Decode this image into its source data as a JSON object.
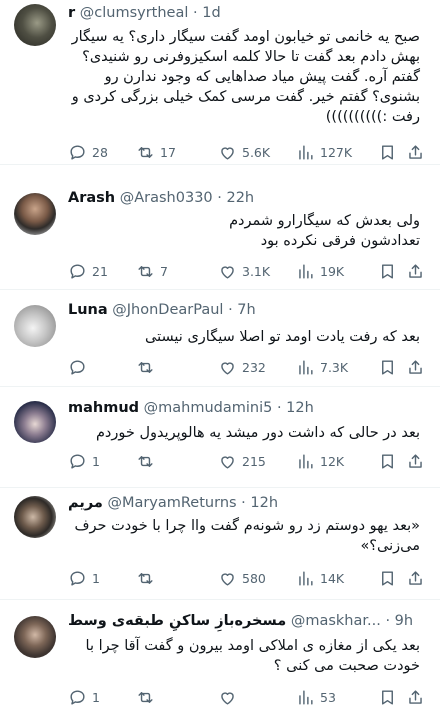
{
  "tweets": [
    {
      "name": "r",
      "handle": "@clumsyrtheal",
      "time": "1d",
      "text": "صبح یه خانمی تو خیابون اومد گفت سیگار داری؟ یه سیگار بهش دادم بعد گفت تا حالا کلمه اسکیزوفرنی رو شنیدی؟ گفتم آره. گفت پیش میاد صداهایی که وجود ندارن رو بشنوی؟ گفتم خیر. گفت مرسی کمک خیلی بزرگی کردی و رفت :))))))))))",
      "replies": "28",
      "retweets": "17",
      "likes": "5.6K",
      "views": "127K"
    },
    {
      "name": "Arash",
      "handle": "@Arash0330",
      "time": "22h",
      "text": "ولی بعدش که سیگارارو شمردم\nتعدادشون فرقی نکرده بود",
      "replies": "21",
      "retweets": "7",
      "likes": "3.1K",
      "views": "19K"
    },
    {
      "name": "Luna",
      "handle": "@JhonDearPaul",
      "time": "7h",
      "text": "بعد که رفت یادت اومد تو اصلا سیگاری نیستی",
      "replies": "",
      "retweets": "",
      "likes": "232",
      "views": "7.3K"
    },
    {
      "name": "mahmud",
      "handle": "@mahmudamini5",
      "time": "12h",
      "text": "بعد در حالی که داشت دور میشد یه هالوپریدول خوردم",
      "replies": "1",
      "retweets": "",
      "likes": "215",
      "views": "12K"
    },
    {
      "name": "مریم",
      "handle": "@MaryamReturns",
      "time": "12h",
      "text": "«بعد یهو دوستم زد رو شونه‌م گفت واا چرا با خودت حرف می‌زنی؟»",
      "replies": "1",
      "retweets": "",
      "likes": "580",
      "views": "14K"
    },
    {
      "name": "مسخره‌بازِ ساکنِ طبقه‌ی وسط",
      "handle": "@maskhar...",
      "time": "9h",
      "text": "بعد یکی از مغازه ی املاکی اومد بیرون و گفت آقا چرا با خودت صحبت می کنی ؟",
      "replies": "1",
      "retweets": "",
      "likes": "",
      "views": "53"
    }
  ],
  "sep": "·",
  "colors": {
    "text": "#0f1419",
    "muted": "#536471",
    "divider": "#eff3f4"
  }
}
